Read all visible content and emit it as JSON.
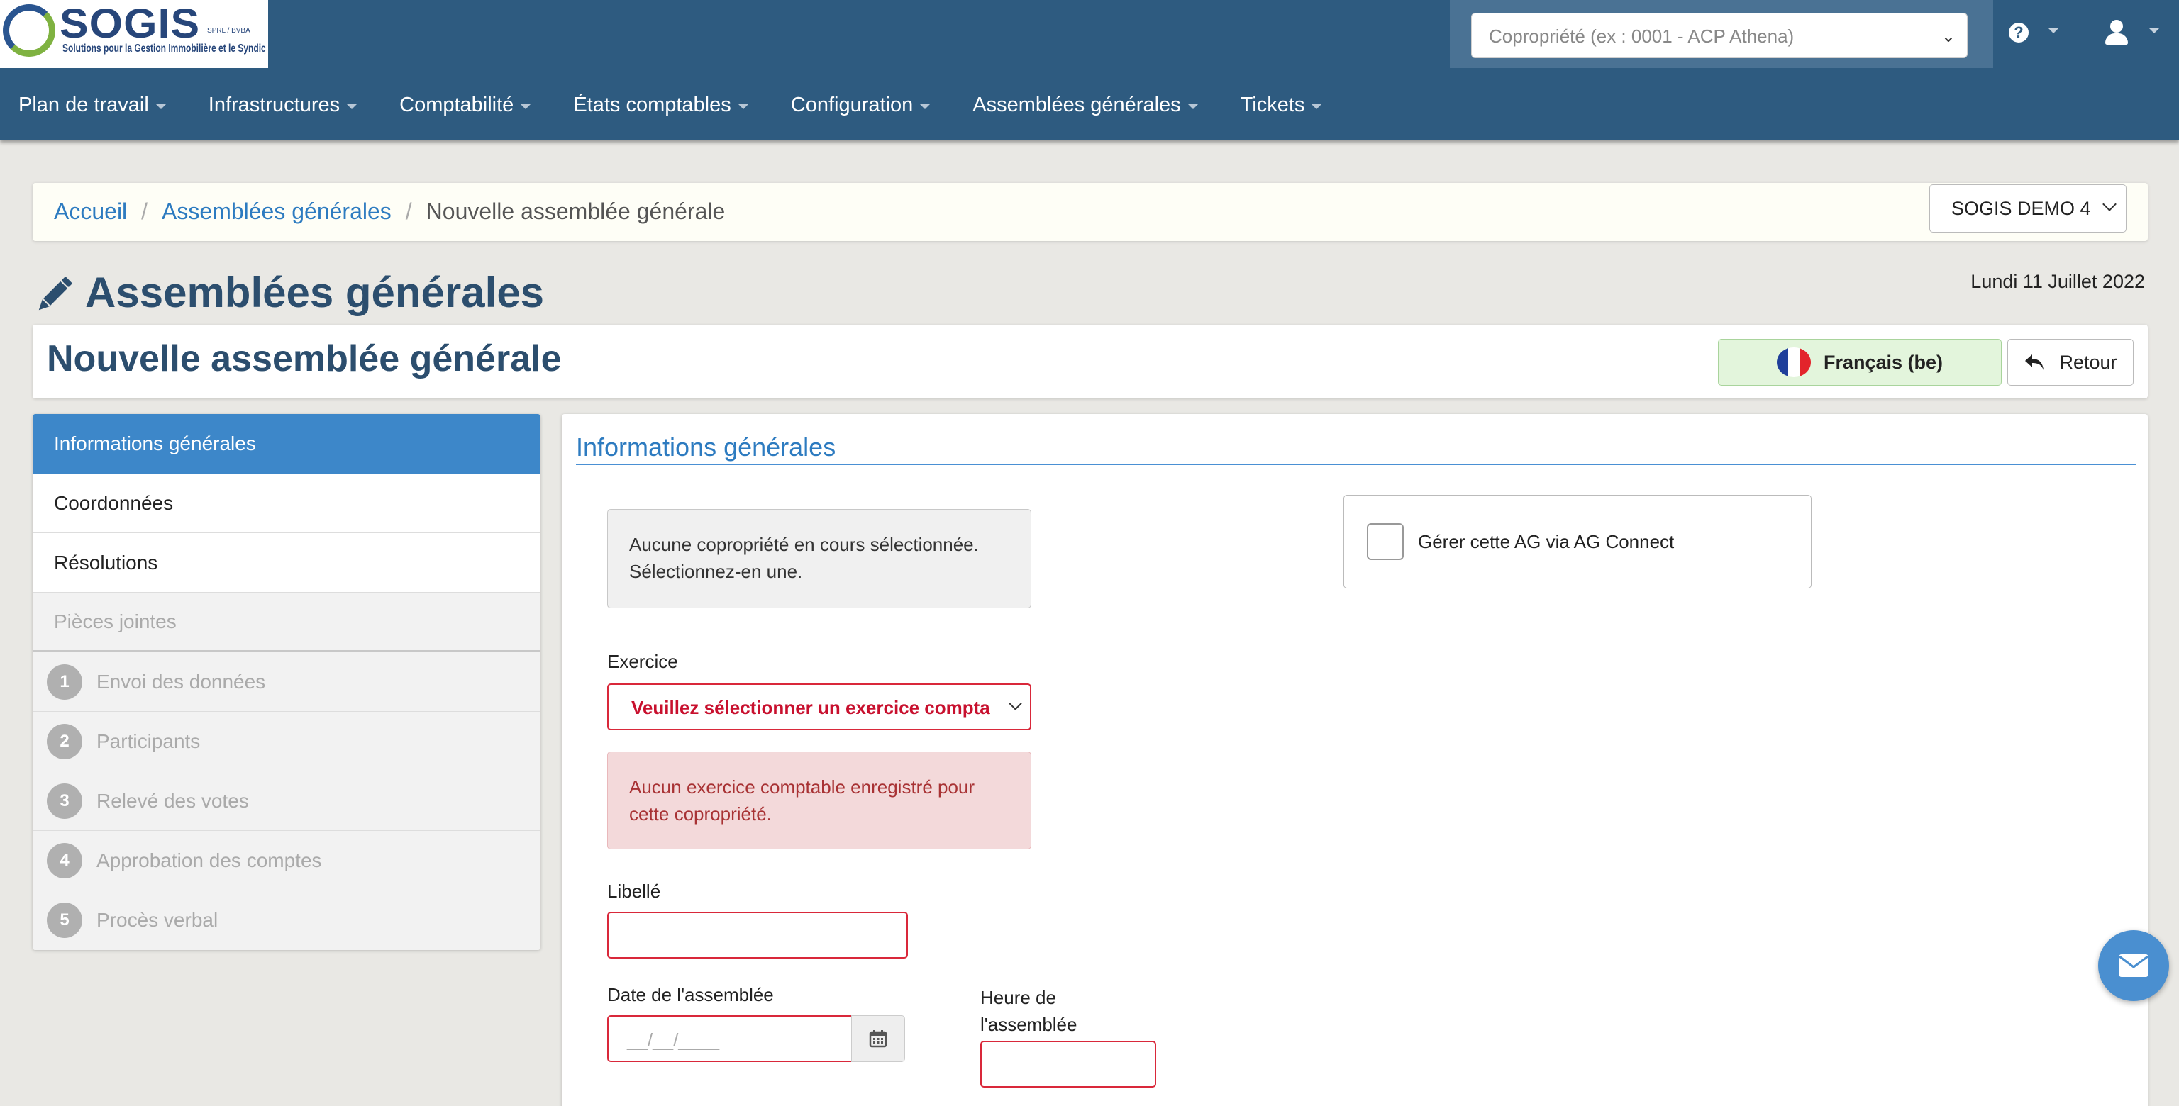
{
  "brand": {
    "name": "SOGIS",
    "legal_form": "SPRL / BVBA",
    "tagline": "Solutions pour la Gestion Immobilière et le Syndic"
  },
  "header": {
    "coprop_placeholder": "Copropriété (ex : 0001 - ACP Athena)"
  },
  "nav": {
    "items": [
      {
        "label": "Plan de travail"
      },
      {
        "label": "Infrastructures"
      },
      {
        "label": "Comptabilité"
      },
      {
        "label": "États comptables"
      },
      {
        "label": "Configuration"
      },
      {
        "label": "Assemblées générales"
      },
      {
        "label": "Tickets"
      }
    ]
  },
  "breadcrumb": {
    "home": "Accueil",
    "section": "Assemblées générales",
    "current": "Nouvelle assemblée générale",
    "separator": "/",
    "company_select": "SOGIS DEMO 4"
  },
  "page": {
    "title": "Assemblées générales",
    "date": "Lundi 11 Juillet 2022",
    "subtitle": "Nouvelle assemblée générale",
    "language_button": "Français (be)",
    "back_button": "Retour"
  },
  "sidebar": {
    "items": [
      {
        "label": "Informations générales",
        "state": "active"
      },
      {
        "label": "Coordonnées",
        "state": "enabled"
      },
      {
        "label": "Résolutions",
        "state": "enabled"
      },
      {
        "label": "Pièces jointes",
        "state": "disabled"
      }
    ],
    "steps": [
      {
        "num": "1",
        "label": "Envoi des données"
      },
      {
        "num": "2",
        "label": "Participants"
      },
      {
        "num": "3",
        "label": "Relevé des votes"
      },
      {
        "num": "4",
        "label": "Approbation des comptes"
      },
      {
        "num": "5",
        "label": "Procès verbal"
      }
    ]
  },
  "form": {
    "section_title": "Informations générales",
    "notice_line1": "Aucune copropriété en cours sélectionnée.",
    "notice_line2": "Sélectionnez-en une.",
    "agconnect_label": "Gérer cette AG via AG Connect",
    "exercice_label": "Exercice",
    "exercice_value": "Veuillez sélectionner un exercice compta",
    "exercice_error_line1": "Aucun exercice comptable enregistré pour",
    "exercice_error_line2": "cette copropriété.",
    "libelle_label": "Libellé",
    "libelle_value": "",
    "date_label": "Date de l'assemblée",
    "date_placeholder": "__/__/____",
    "heure_label_line1": "Heure de",
    "heure_label_line2": "l'assemblée",
    "heure_value": ""
  },
  "colors": {
    "header_bg": "#2e5b80",
    "accent": "#3d87c9",
    "error": "#d9283a",
    "success_bg": "#e3f5dc"
  },
  "icons": {
    "help": "help-icon",
    "user": "user-icon",
    "edit": "pencil-icon",
    "back": "reply-icon",
    "calendar": "calendar-icon",
    "mail": "envelope-icon"
  }
}
